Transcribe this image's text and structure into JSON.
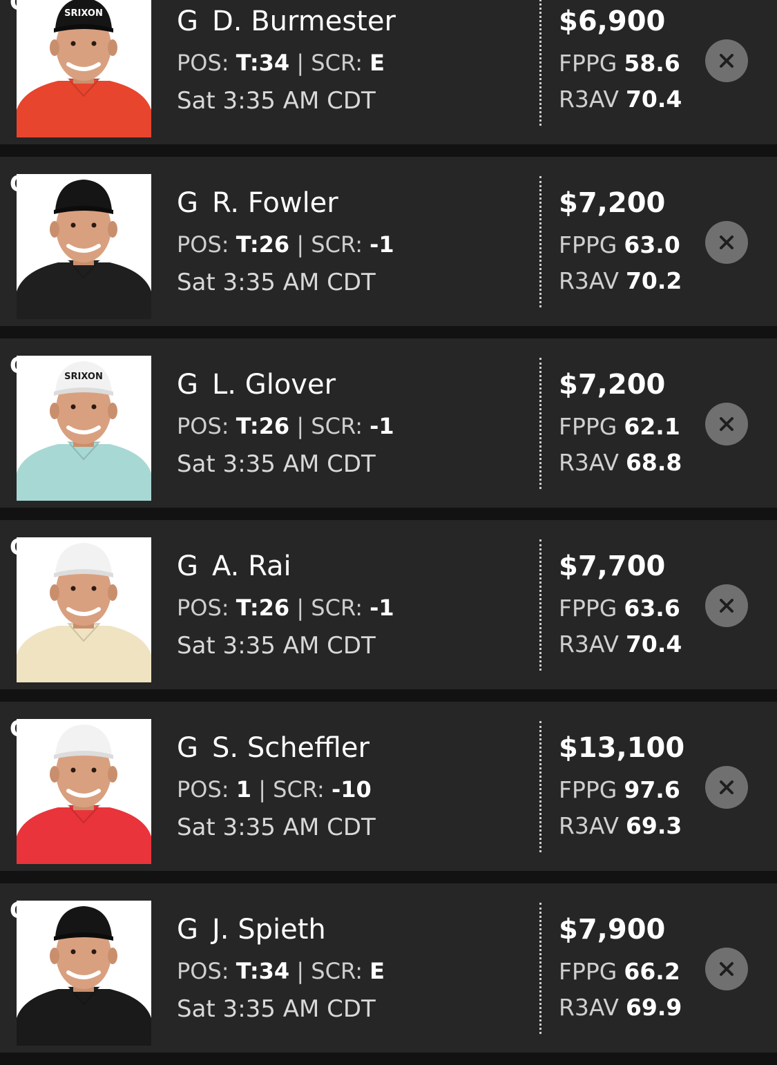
{
  "players": [
    {
      "slot": "G",
      "position": "G",
      "name": "D. Burmester",
      "pos_label": "POS:",
      "pos": "T:34",
      "scr_label": "SCR:",
      "scr": "E",
      "time": "Sat 3:35 AM CDT",
      "salary": "$6,900",
      "fppg_label": "FPPG",
      "fppg": "58.6",
      "r3av_label": "R3AV",
      "r3av": "70.4",
      "shirt_color": "#e8452e",
      "cap": "black",
      "cap_text": "SRIXON"
    },
    {
      "slot": "G",
      "position": "G",
      "name": "R. Fowler",
      "pos_label": "POS:",
      "pos": "T:26",
      "scr_label": "SCR:",
      "scr": "-1",
      "time": "Sat 3:35 AM CDT",
      "salary": "$7,200",
      "fppg_label": "FPPG",
      "fppg": "63.0",
      "r3av_label": "R3AV",
      "r3av": "70.2",
      "shirt_color": "#1f1f1f",
      "cap": "black",
      "cap_text": ""
    },
    {
      "slot": "G",
      "position": "G",
      "name": "L. Glover",
      "pos_label": "POS:",
      "pos": "T:26",
      "scr_label": "SCR:",
      "scr": "-1",
      "time": "Sat 3:35 AM CDT",
      "salary": "$7,200",
      "fppg_label": "FPPG",
      "fppg": "62.1",
      "r3av_label": "R3AV",
      "r3av": "68.8",
      "shirt_color": "#a8d8d4",
      "cap": "white",
      "cap_text": "SRIXON"
    },
    {
      "slot": "G",
      "position": "G",
      "name": "A. Rai",
      "pos_label": "POS:",
      "pos": "T:26",
      "scr_label": "SCR:",
      "scr": "-1",
      "time": "Sat 3:35 AM CDT",
      "salary": "$7,700",
      "fppg_label": "FPPG",
      "fppg": "63.6",
      "r3av_label": "R3AV",
      "r3av": "70.4",
      "shirt_color": "#efe3c2",
      "cap": "white",
      "cap_text": ""
    },
    {
      "slot": "G",
      "position": "G",
      "name": "S. Scheffler",
      "pos_label": "POS:",
      "pos": "1",
      "scr_label": "SCR:",
      "scr": "-10",
      "time": "Sat 3:35 AM CDT",
      "salary": "$13,100",
      "fppg_label": "FPPG",
      "fppg": "97.6",
      "r3av_label": "R3AV",
      "r3av": "69.3",
      "shirt_color": "#e8343a",
      "cap": "white",
      "cap_text": ""
    },
    {
      "slot": "G",
      "position": "G",
      "name": "J. Spieth",
      "pos_label": "POS:",
      "pos": "T:34",
      "scr_label": "SCR:",
      "scr": "E",
      "time": "Sat 3:35 AM CDT",
      "salary": "$7,900",
      "fppg_label": "FPPG",
      "fppg": "66.2",
      "r3av_label": "R3AV",
      "r3av": "69.9",
      "shirt_color": "#1a1a1a",
      "cap": "black",
      "cap_text": ""
    }
  ],
  "icons": {
    "remove": "close-icon",
    "photo": "player-headshot"
  }
}
